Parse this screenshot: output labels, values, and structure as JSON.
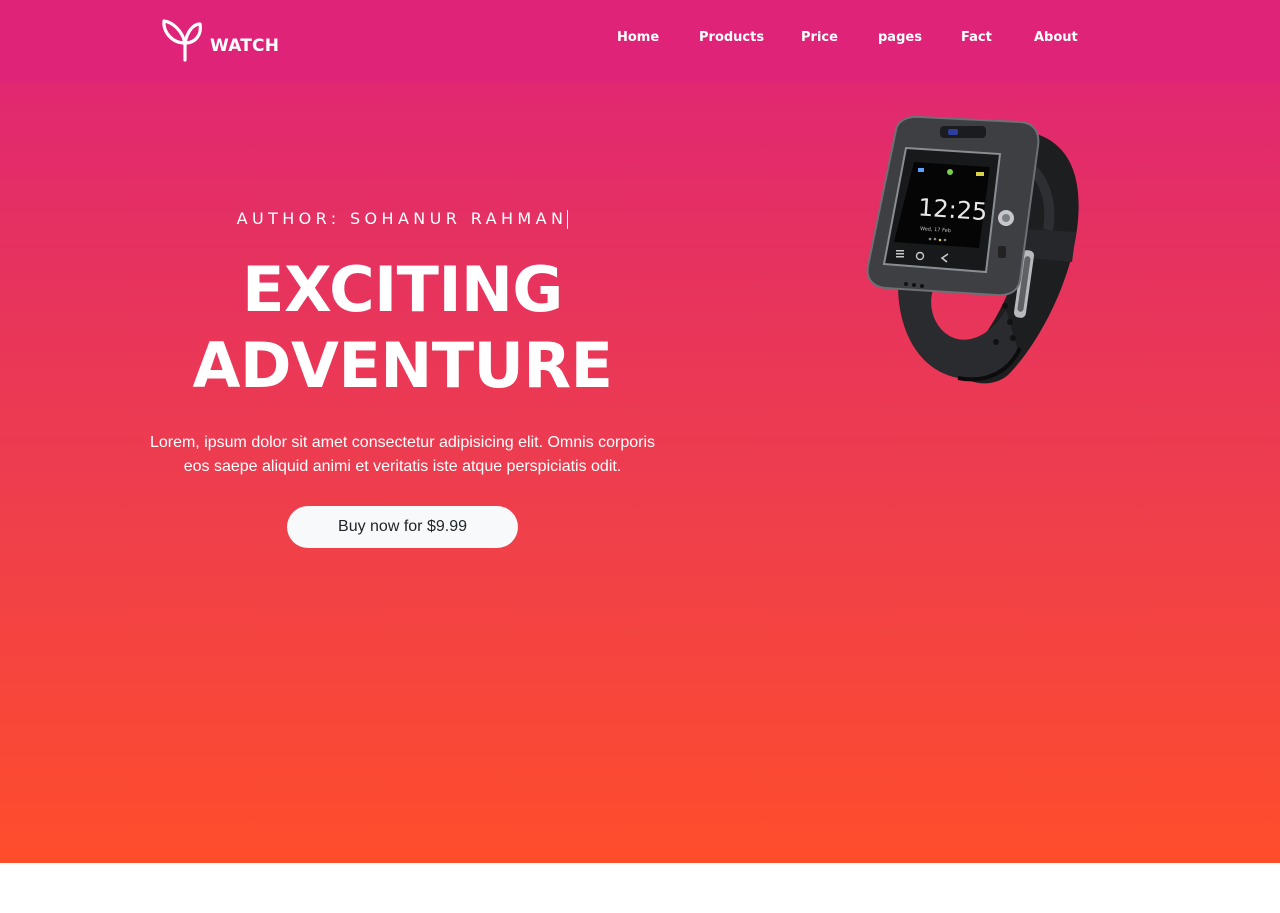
{
  "brand": {
    "name": "WATCH",
    "icon": "sprout-icon"
  },
  "nav": {
    "items": [
      {
        "label": "Home"
      },
      {
        "label": "Products"
      },
      {
        "label": "Price"
      },
      {
        "label": "pages"
      },
      {
        "label": "Fact"
      },
      {
        "label": "About"
      }
    ]
  },
  "hero": {
    "author": "AUTHOR: SOHANUR RAHMAN",
    "headline_line1": "EXCITING",
    "headline_line2": "ADVENTURE",
    "description": "Lorem, ipsum dolor sit amet consectetur adipisicing elit. Omnis corporis eos saepe aliquid animi et veritatis iste atque perspiciatis odit.",
    "cta_label": "Buy now for $9.99",
    "watch_time": "12:25",
    "watch_date": "Wed, 17 Feb",
    "image": "smartwatch-image"
  },
  "colors": {
    "gradient_top": "#de2379",
    "gradient_bottom": "#ff4d2c",
    "button_bg": "#f8f9fa",
    "button_text": "#212529"
  }
}
